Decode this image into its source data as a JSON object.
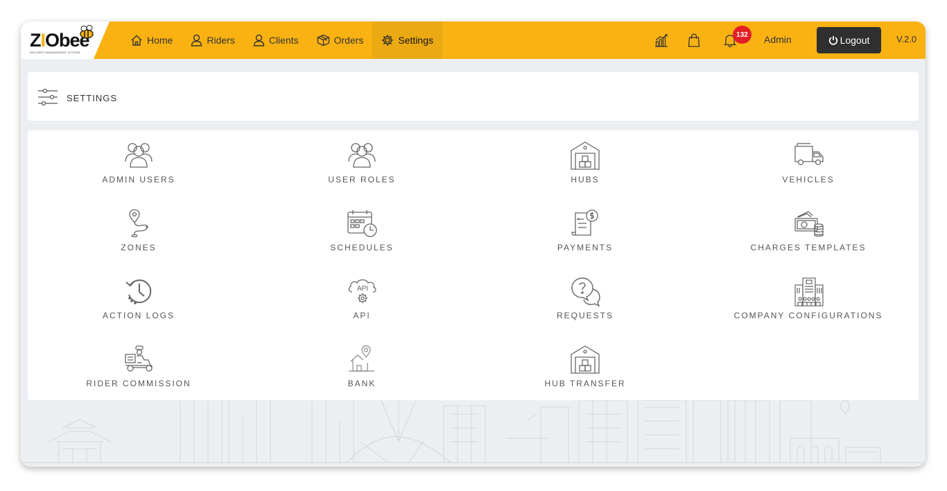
{
  "brand": {
    "logo_text": "Z",
    "logo_mid": "I",
    "logo_end": "Obee",
    "tagline": "DELIVERY MANAGEMENT SYSTEM",
    "accent": "#f9b212"
  },
  "nav": [
    {
      "label": "Home",
      "icon": "home-icon"
    },
    {
      "label": "Riders",
      "icon": "user-icon"
    },
    {
      "label": "Clients",
      "icon": "user-icon"
    },
    {
      "label": "Orders",
      "icon": "box-icon"
    },
    {
      "label": "Settings",
      "icon": "gear-icon",
      "active": true
    }
  ],
  "topbar": {
    "notifications": "132",
    "user": "Admin",
    "logout_label": "Logout",
    "version": "V.2.0"
  },
  "page": {
    "title": "SETTINGS"
  },
  "tiles": [
    {
      "label": "ADMIN USERS",
      "icon": "users-icon"
    },
    {
      "label": "USER ROLES",
      "icon": "users-icon"
    },
    {
      "label": "HUBS",
      "icon": "warehouse-icon"
    },
    {
      "label": "VEHICLES",
      "icon": "truck-icon"
    },
    {
      "label": "ZONES",
      "icon": "map-pin-route-icon"
    },
    {
      "label": "SCHEDULES",
      "icon": "calendar-clock-icon"
    },
    {
      "label": "PAYMENTS",
      "icon": "invoice-dollar-icon"
    },
    {
      "label": "CHARGES TEMPLATES",
      "icon": "cash-coins-icon"
    },
    {
      "label": "ACTION LOGS",
      "icon": "history-icon"
    },
    {
      "label": "API",
      "icon": "api-gear-icon"
    },
    {
      "label": "REQUESTS",
      "icon": "question-chat-icon"
    },
    {
      "label": "COMPANY CONFIGURATIONS",
      "icon": "building-icon"
    },
    {
      "label": "RIDER COMMISSION",
      "icon": "delivery-scooter-icon"
    },
    {
      "label": "BANK",
      "icon": "house-pin-icon"
    },
    {
      "label": "HUB TRANSFER",
      "icon": "warehouse-icon"
    }
  ]
}
